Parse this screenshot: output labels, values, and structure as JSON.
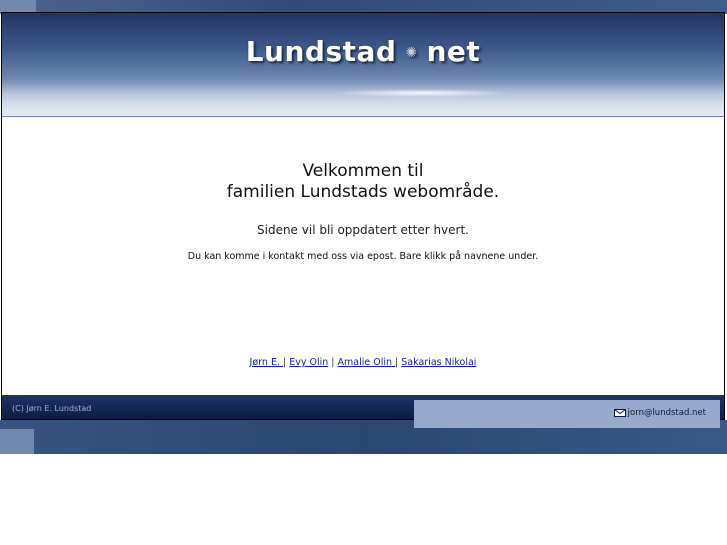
{
  "header": {
    "logo_left": "Lundstad",
    "logo_sep": "dot",
    "logo_right": "net"
  },
  "main": {
    "welcome_line1": "Velkommen til",
    "welcome_line2": "familien Lundstads webområde.",
    "update_text": "Sidene vil bli oppdatert etter hvert.",
    "contact_text": "Du kan komme i kontakt med oss via epost. Bare klikk på navnene under."
  },
  "links": [
    {
      "label": "Jørn E. "
    },
    {
      "label": "Evy Olin"
    },
    {
      "label": "Amalie Olin "
    },
    {
      "label": "Sakarias Nikolai"
    }
  ],
  "links_separator": " | ",
  "footer": {
    "copyright": "(C) Jørn E. Lundstad",
    "email": "jorn@lundstad.net",
    "email_icon": "mail-icon"
  },
  "colors": {
    "header_dark": "#1d3563",
    "footer_dark": "#0c1d44",
    "link": "#1a1aa6"
  }
}
